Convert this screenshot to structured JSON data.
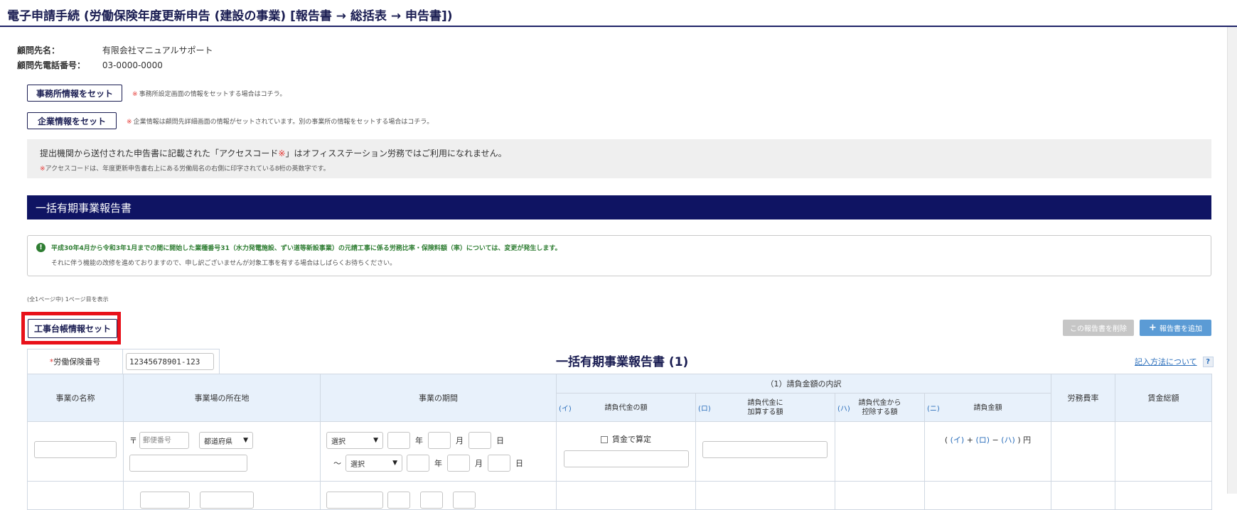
{
  "header": {
    "title": "電子申請手続 (労働保険年度更新申告 (建設の事業) [報告書 → 総括表 → 申告書])"
  },
  "client": {
    "name_label": "顧問先名：",
    "name_value": "有限会社マニュアルサポート",
    "phone_label": "顧問先電話番号：",
    "phone_value": "03-0000-0000"
  },
  "office_set": {
    "button": "事務所情報をセット",
    "note_mark": "※",
    "note": "事務所設定画面の情報をセットする場合はコチラ。"
  },
  "company_set": {
    "button": "企業情報をセット",
    "note_mark": "※",
    "note": "企業情報は顧問先詳細画面の情報がセットされています。別の事業所の情報をセットする場合はコチラ。"
  },
  "access_notice": {
    "line1_a": "提出機関から送付された申告書に記載された「アクセスコード",
    "line1_mark": "※",
    "line1_b": "」はオフィスステーション労務ではご利用になれません。",
    "line2_mark": "※",
    "line2": "アクセスコードは、年度更新申告書右上にある労働局名の右側に印字されている8桁の英数字です。"
  },
  "section": {
    "title": "一括有期事業報告書"
  },
  "info": {
    "icon": "!",
    "line1": "平成30年4月から令和3年1月までの間に開始した業種番号31（水力発電施設、ずい道等新設事業）の元請工事に係る労務比率・保険料額（率）については、変更が発生します。",
    "line2": "それに伴う機能の改修を進めておりますので、申し訳ございませんが対象工事を有する場合はしばらくお待ちください。"
  },
  "pagination": {
    "text": "(全1ページ中) 1ページ目を表示"
  },
  "buttons": {
    "koji": "工事台帳情報セット",
    "delete": "この報告書を削除",
    "add": "報告書を追加",
    "add_icon": "+"
  },
  "insurance": {
    "req": "*",
    "label": "労働保険番号",
    "value": "12345678901-123"
  },
  "report": {
    "title": "一括有期事業報告書 (1)",
    "howto": "記入方法について",
    "help": "?"
  },
  "table": {
    "col_name": "事業の名称",
    "col_address": "事業場の所在地",
    "col_period": "事業の期間",
    "col_group": "（1）請負金額の内訳",
    "sub_a_key": "(イ)",
    "sub_a": "請負代金の額",
    "sub_b_key": "(ロ)",
    "sub_b1": "請負代金に",
    "sub_b2": "加算する額",
    "sub_c_key": "(ハ)",
    "sub_c1": "請負代金から",
    "sub_c2": "控除する額",
    "sub_d_key": "(ニ)",
    "sub_d": "請負金額",
    "col_rate": "労務費率",
    "col_wage": "賃金総額"
  },
  "row": {
    "postal_mark": "〒",
    "postal_placeholder": "郵便番号",
    "pref": "都道府県",
    "select": "選択",
    "year": "年",
    "month": "月",
    "day": "日",
    "tilde": "～",
    "wage_calc": "賃金で算定",
    "f_open": "(",
    "f_a": "(イ)",
    "f_plus": "+",
    "f_b": "(ロ)",
    "f_minus": "−",
    "f_c": "(ハ)",
    "f_close": ")",
    "f_unit": "円"
  }
}
